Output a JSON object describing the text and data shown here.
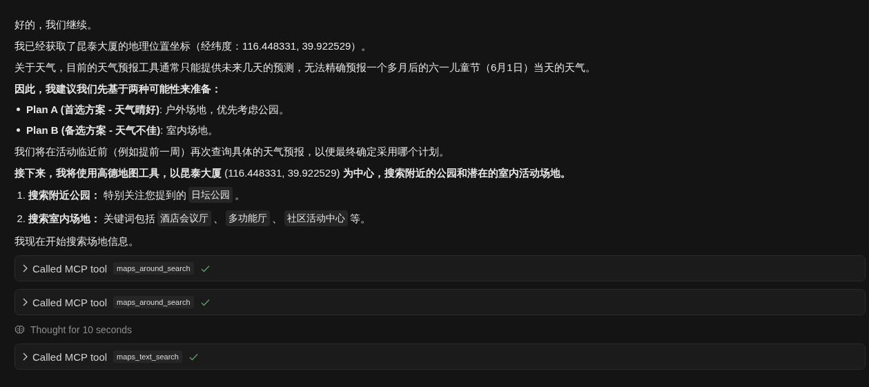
{
  "blocks": [
    {
      "kind": "paragraph",
      "text": "好的，我们继续。"
    },
    {
      "kind": "paragraph",
      "text": "我已经获取了昆泰大厦的地理位置坐标（经纬度：116.448331, 39.922529）。"
    },
    {
      "kind": "paragraph",
      "text": "关于天气，目前的天气预报工具通常只能提供未来几天的预测，无法精确预报一个多月后的六一儿童节（6月1日）当天的天气。"
    },
    {
      "kind": "strong",
      "text": "因此，我建议我们先基于两种可能性来准备："
    },
    {
      "kind": "bullets",
      "items": [
        "**Plan A (首选方案 - 天气晴好)**: 户外场地，优先考虑公园。",
        "**Plan B (备选方案 - 天气不佳)**: 室内场地。"
      ]
    },
    {
      "kind": "paragraph",
      "text": "我们将在活动临近前（例如提前一周）再次查询具体的天气预报，以便最终确定采用哪个计划。"
    },
    {
      "kind": "paragraph",
      "text": "**接下来，我将使用高德地图工具，以昆泰大厦** (116.448331, 39.922529) **为中心，搜索附近的公园和潜在的室内活动场地。**"
    },
    {
      "kind": "numbered",
      "items": [
        {
          "number": "1.",
          "parts": [
            {
              "text": "**搜索附近公园：** 特别关注您提到的"
            },
            {
              "code": "日坛公园"
            },
            {
              "text": "。"
            }
          ]
        },
        {
          "number": "2.",
          "parts": [
            {
              "text": "**搜索室内场地：** 关键词包括"
            },
            {
              "code": "酒店会议厅"
            },
            {
              "text": "、"
            },
            {
              "code": "多功能厅"
            },
            {
              "text": "、"
            },
            {
              "code": "社区活动中心"
            },
            {
              "text": "等。"
            }
          ]
        }
      ]
    },
    {
      "kind": "paragraph",
      "text": "我现在开始搜索场地信息。"
    },
    {
      "kind": "tool",
      "label": "Called MCP tool",
      "tool": "maps_around_search",
      "expanded": false,
      "done": true
    },
    {
      "kind": "tool",
      "label": "Called MCP tool",
      "tool": "maps_around_search",
      "expanded": false,
      "done": true
    },
    {
      "kind": "thought",
      "text": "Thought for 10 seconds"
    },
    {
      "kind": "tool",
      "label": "Called MCP tool",
      "tool": "maps_text_search",
      "expanded": false,
      "done": true
    }
  ]
}
